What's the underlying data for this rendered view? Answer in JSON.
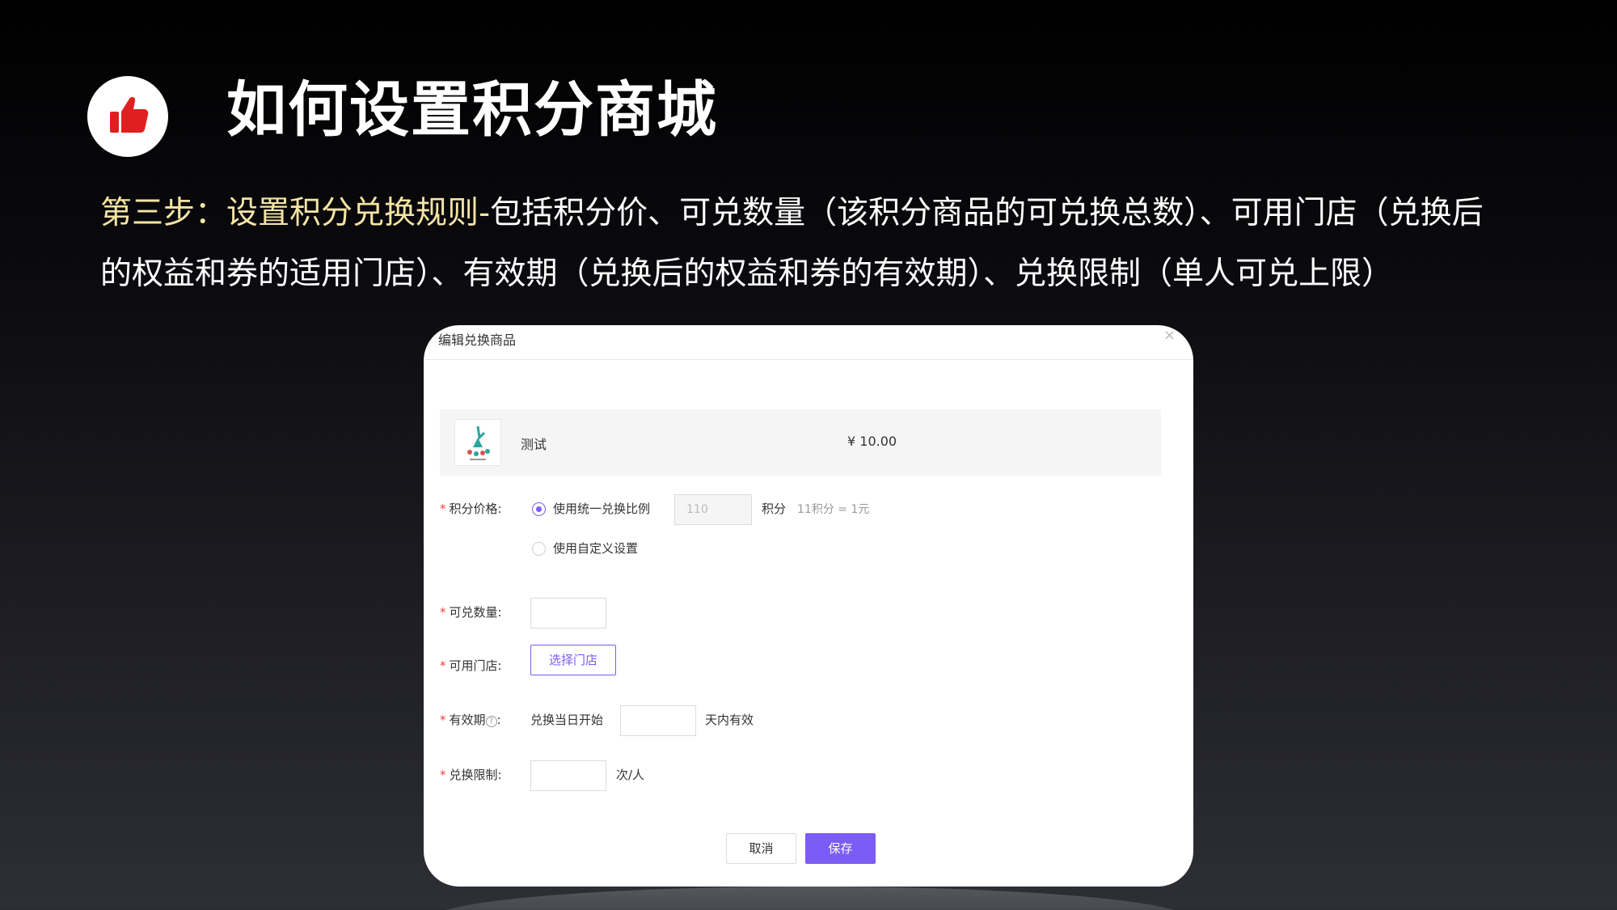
{
  "slide": {
    "title": "如何设置积分商城",
    "step_label": "第三步：设置积分兑换规则-",
    "step_text": "包括积分价、可兑数量（该积分商品的可兑换总数）、可用门店（兑换后的权益和券的适用门店）、有效期（兑换后的权益和券的有效期）、兑换限制（单人可兑上限）",
    "icon": "thumbs-up-icon",
    "highlight_color": "#f5e4a4"
  },
  "dialog": {
    "title": "编辑兑换商品",
    "close_icon": "×",
    "product": {
      "name": "测试",
      "price": "¥ 10.00"
    },
    "form": {
      "points_price": {
        "label": "积分价格:",
        "option_unified": "使用统一兑换比例",
        "unified_value": "110",
        "unit": "积分",
        "ratio_hint": "11积分 = 1元",
        "option_custom": "使用自定义设置",
        "selected": "unified"
      },
      "quantity": {
        "label": "可兑数量:",
        "value": ""
      },
      "stores": {
        "label": "可用门店:",
        "button": "选择门店"
      },
      "validity": {
        "label": "有效期",
        "colon": ":",
        "prefix": "兑换当日开始",
        "value": "",
        "suffix": "天内有效"
      },
      "limit": {
        "label": "兑换限制:",
        "value": "",
        "suffix": "次/人"
      }
    },
    "buttons": {
      "cancel": "取消",
      "save": "保存"
    },
    "accent_color": "#7b5cf5"
  }
}
